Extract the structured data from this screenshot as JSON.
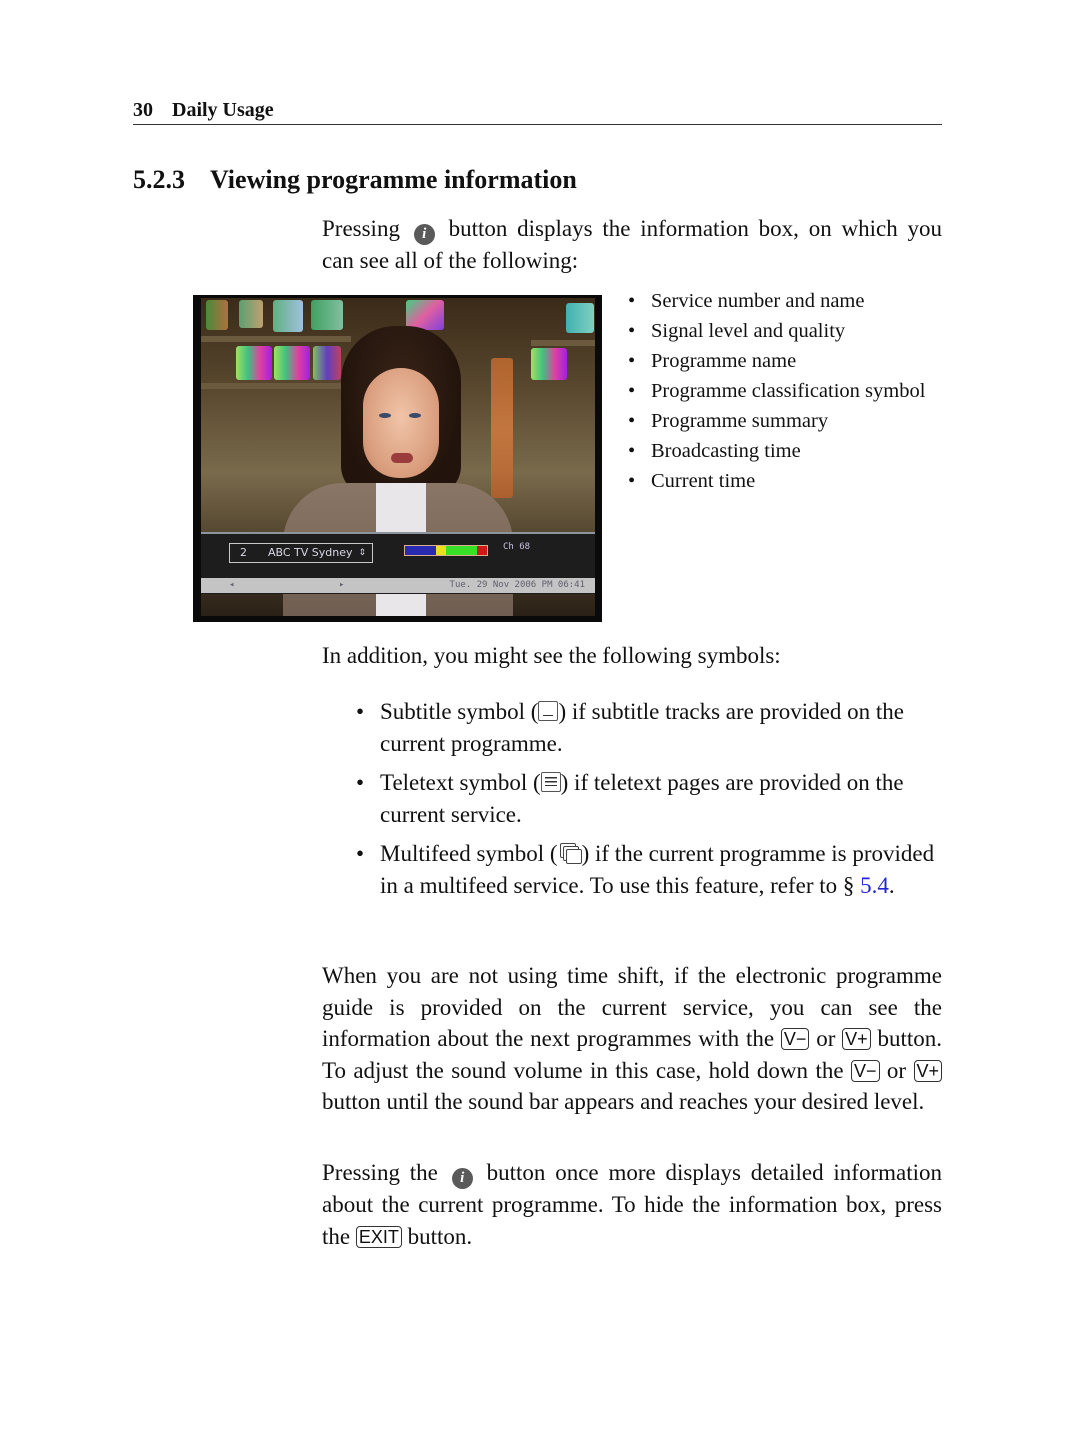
{
  "header": {
    "page_number": "30",
    "chapter_title": "Daily Usage"
  },
  "section": {
    "number": "5.2.3",
    "title": "Viewing programme information"
  },
  "intro": {
    "before_icon": "Pressing",
    "icon": "info-button-icon",
    "icon_glyph": "i",
    "after_icon": "button displays the information box, on which you can see all of the following:"
  },
  "features": [
    "Service number and name",
    "Signal level and quality",
    "Programme name",
    "Programme classification symbol",
    "Programme summary",
    "Broadcasting time",
    "Current time"
  ],
  "tv_screenshot": {
    "service_number": "2",
    "service_name": "ABC TV Sydney",
    "service_arrows": "⇕",
    "channel": "Ch 68",
    "signal_segments": [
      {
        "color": "#2a2ab0",
        "fraction": 0.38
      },
      {
        "color": "#e8e020",
        "fraction": 0.12
      },
      {
        "color": "#38e028",
        "fraction": 0.38
      },
      {
        "color": "#d01818",
        "fraction": 0.12
      }
    ],
    "nav_left": "◂",
    "nav_right": "▸",
    "datetime": "Tue. 29 Nov 2006 PM 06:41"
  },
  "symbols_intro": "In addition, you might see the following symbols:",
  "symbols": [
    {
      "icon": "subtitle-icon",
      "name_text": "Subtitle symbol (",
      "after_text": ") if subtitle tracks are provided on the current programme."
    },
    {
      "icon": "teletext-icon",
      "name_text": "Teletext symbol (",
      "after_text": ") if teletext pages are provided on the current service."
    },
    {
      "icon": "multifeed-icon",
      "name_text": "Multifeed symbol (",
      "after_text": ") if the current programme is provided in a multifeed service. To use this feature, refer to §",
      "link_text": "5.4",
      "end_text": "."
    }
  ],
  "epg_paragraph": {
    "part1": "When you are not using time shift, if the electronic programme guide is provided on the current service, you can see the information about the next programmes with the",
    "key_vminus": "V−",
    "or1": "or",
    "key_vplus": "V+",
    "part2": "button. To adjust the sound volume in this case, hold down the",
    "or2": "or",
    "part3": "button until the sound bar appears and reaches your desired level."
  },
  "detail_paragraph": {
    "part1": "Pressing the",
    "icon_glyph": "i",
    "part2": "button once more displays detailed information about the current programme.  To hide the information box, press the",
    "key_exit": "EXIT",
    "part3": "button."
  }
}
